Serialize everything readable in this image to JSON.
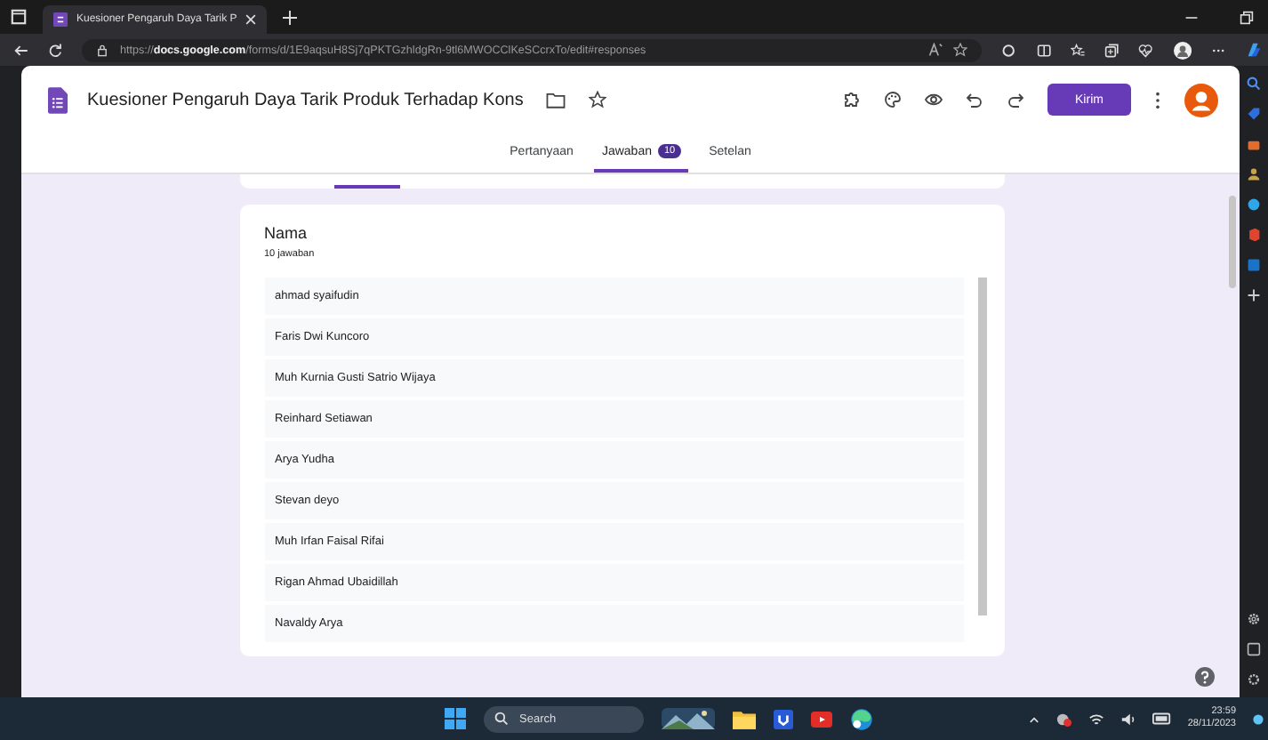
{
  "browser": {
    "tab_title": "Kuesioner Pengaruh Daya Tarik P",
    "url": "https://**docs.google.com**/forms/d/1E9aqsuH8Sj7qPKTGzhldgRn-9tl6MWOCClKeSCcrxTo/edit#responses"
  },
  "form": {
    "title": "Kuesioner Pengaruh Daya Tarik Produk Terhadap Kons",
    "send_button": "Kirim"
  },
  "tabs": [
    {
      "label": "Pertanyaan",
      "selected": false
    },
    {
      "label": "Jawaban",
      "badge": "10",
      "selected": true
    },
    {
      "label": "Setelan",
      "selected": false
    }
  ],
  "question": {
    "title": "Nama",
    "count": "10 jawaban",
    "answers": [
      "ahmad syaifudin",
      "Faris Dwi Kuncoro",
      "Muh Kurnia Gusti Satrio Wijaya",
      "Reinhard Setiawan",
      "Arya Yudha",
      "Stevan deyo",
      "Muh Irfan Faisal Rifai",
      "Rigan Ahmad Ubaidillah",
      "Navaldy Arya"
    ]
  },
  "taskbar": {
    "search_placeholder": "Search",
    "time": "23:59",
    "date": "28/11/2023"
  }
}
